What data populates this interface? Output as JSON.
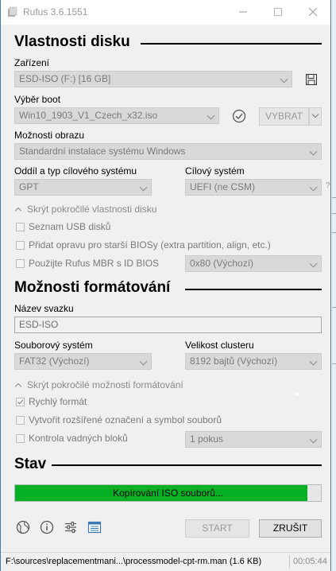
{
  "window": {
    "title": "Rufus 3.6.1551"
  },
  "drive_properties": {
    "title": "Vlastnosti disku",
    "device_label": "Zařízení",
    "device_value": "ESD-ISO (F:) [16 GB]",
    "boot_label": "Výběr boot",
    "boot_value": "Win10_1903_V1_Czech_x32.iso",
    "select_button": "VYBRAT",
    "image_option_label": "Možnosti obrazu",
    "image_option_value": "Standardní instalace systému Windows",
    "partition_label": "Oddíl a typ cílového systému",
    "partition_value": "GPT",
    "target_label": "Cílový systém",
    "target_value": "UEFI (ne CSM)",
    "help_mark": "?",
    "advanced_toggle": "Skrýt pokročilé vlastnosti disku",
    "list_usb": "Seznam USB disků",
    "old_bios_fix": "Přidat opravu pro starší BIOSy (extra partition, align, etc.)",
    "use_mbr": "Použijte Rufus MBR s ID BIOS",
    "bios_id_value": "0x80 (Výchozí)"
  },
  "format_options": {
    "title": "Možnosti formátování",
    "volume_label": "Název svazku",
    "volume_value": "ESD-ISO",
    "fs_label": "Souborový systém",
    "fs_value": "FAT32 (Výchozí)",
    "cluster_label": "Velikost clusteru",
    "cluster_value": "8192 bajtů (Výchozí)",
    "advanced_toggle": "Skrýt pokročilé možnosti formátování",
    "quick_format": "Rychlý formát",
    "extended_label": "Vytvořit rozšířené označení a symbol souborů",
    "bad_blocks": "Kontrola vadných bloků",
    "passes_value": "1 pokus"
  },
  "status": {
    "title": "Stav",
    "progress_text": "Kopírování ISO souborů...",
    "progress_fraction": 0.955
  },
  "buttons": {
    "start": "START",
    "cancel": "ZRUŠIT"
  },
  "icons": [
    "globe-icon",
    "info-icon",
    "settings-sliders-icon",
    "log-icon",
    "save-icon",
    "checksum-check-icon"
  ],
  "statusbar": {
    "path": "F:\\sources\\replacementmani...\\processmodel-cpt-rm.man (1.6 KB)",
    "time": "00:05:44"
  },
  "colors": {
    "progress": "#06b025",
    "window_border": "#3c7fb1"
  }
}
